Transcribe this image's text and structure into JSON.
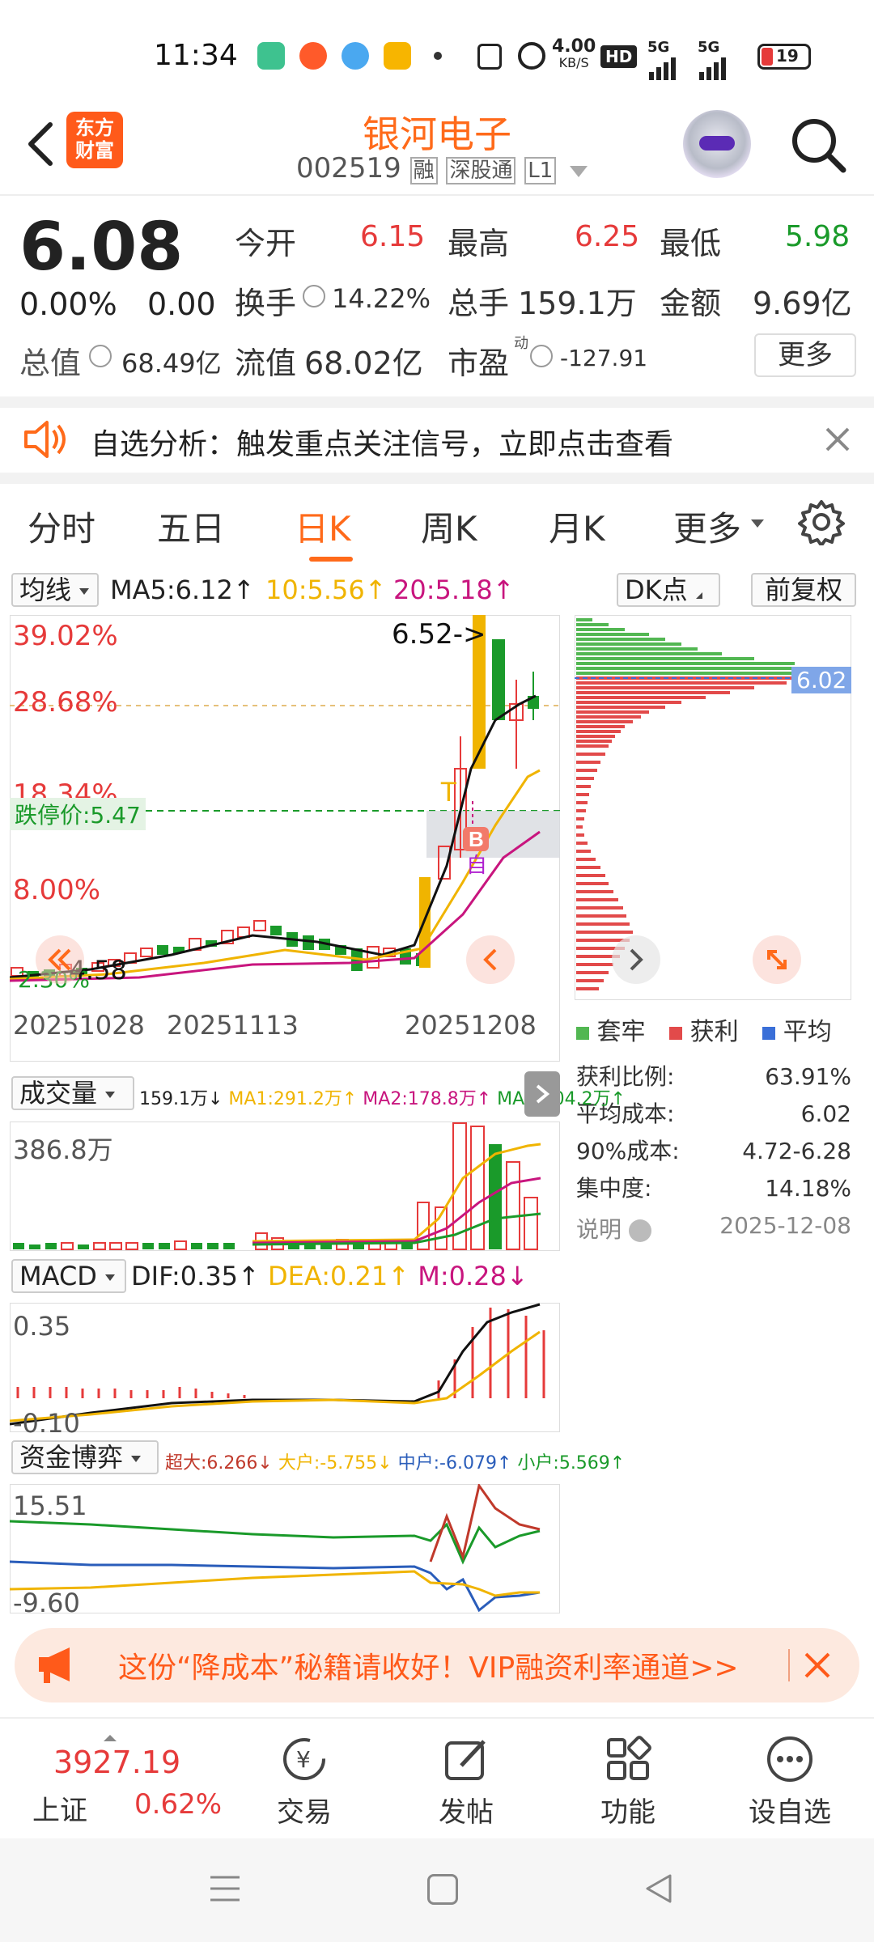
{
  "status_bar": {
    "time": "11:34",
    "net_speed_value": "4.00",
    "net_speed_unit": "KB/S",
    "hd": "HD",
    "sig1": "5G",
    "sig2": "5G",
    "battery": "19"
  },
  "header": {
    "logo_line1": "东方",
    "logo_line2": "财富",
    "stock_name": "银河电子",
    "stock_code": "002519",
    "tag_rong": "融",
    "tag_sgt": "深股通",
    "tag_l1": "L1"
  },
  "quote": {
    "price": "6.08",
    "change_pct": "0.00%",
    "change_amt": "0.00",
    "open_label": "今开",
    "open_value": "6.15",
    "high_label": "最高",
    "high_value": "6.25",
    "low_label": "最低",
    "low_value": "5.98",
    "turnover_label": "换手",
    "turnover_value": "14.22%",
    "volume_label": "总手",
    "volume_value": "159.1万",
    "amount_label": "金额",
    "amount_value": "9.69亿",
    "mcap_label": "总值",
    "mcap_value": "68.49亿",
    "float_label": "流值",
    "float_value": "68.02亿",
    "pe_label": "市盈",
    "pe_sup": "动",
    "pe_value": "-127.91",
    "more_button": "更多"
  },
  "notice": {
    "text": "自选分析：触发重点关注信号，立即点击查看"
  },
  "tabs": [
    {
      "label": "分时"
    },
    {
      "label": "五日"
    },
    {
      "label": "日K"
    },
    {
      "label": "周K"
    },
    {
      "label": "月K"
    },
    {
      "label": "更多"
    }
  ],
  "kline": {
    "indicator_select": "均线",
    "ma5": "MA5:6.12",
    "ma10": "10:5.56",
    "ma20": "20:5.18",
    "dk_button": "DK点",
    "adjust_button": "前复权",
    "y_top": "39.02%",
    "y_mid": "28.68%",
    "y_low": "18.34%",
    "y_bot": "8.00%",
    "y_min": "2.30%",
    "high_annot": "6.52->",
    "low_annot": "4.58",
    "limit_down": "跌停价:5.47",
    "marker_b": "B",
    "marker_zi": "自",
    "marker_t": "T",
    "dates": [
      "20251028",
      "20251113",
      "20251208"
    ]
  },
  "chip": {
    "price_tag": "6.02",
    "legend_trapped": "套牢",
    "legend_profit": "获利",
    "legend_avg": "平均",
    "rows": [
      {
        "label": "获利比例:",
        "value": "63.91%"
      },
      {
        "label": "平均成本:",
        "value": "6.02"
      },
      {
        "label": "90%成本:",
        "value": "4.72-6.28"
      },
      {
        "label": "集中度:",
        "value": "14.18%"
      }
    ],
    "note_label": "说明",
    "note_date": "2025-12-08"
  },
  "volume": {
    "select": "成交量",
    "v": "159.1万",
    "ma1": "MA1:291.2万",
    "ma2": "MA2:178.8万",
    "ma3": "MA3:104.2万",
    "y_top": "386.8万"
  },
  "macd": {
    "select": "MACD",
    "dif": "DIF:0.35",
    "dea": "DEA:0.21",
    "m": "M:0.28",
    "y_top": "0.35",
    "y_bot": "-0.10"
  },
  "fund": {
    "select": "资金博弈",
    "super": "超大:6.266",
    "big": "大户:-5.755",
    "mid": "中户:-6.079",
    "small": "小户:5.569",
    "y_top": "15.51",
    "y_bot": "-9.60"
  },
  "banner": {
    "text": "这份“降成本”秘籍请收好！VIP融资利率通道>>"
  },
  "bottom_nav": {
    "index_value": "3927.19",
    "index_name": "上证",
    "index_change": "0.62%",
    "items": [
      {
        "label": "交易"
      },
      {
        "label": "发帖"
      },
      {
        "label": "功能"
      },
      {
        "label": "设自选"
      }
    ]
  },
  "colors": {
    "accent": "#ff6a1a",
    "up": "#e63a3a",
    "down": "#1a9a2a",
    "ma10": "#f0b400",
    "ma20": "#c8157e"
  }
}
